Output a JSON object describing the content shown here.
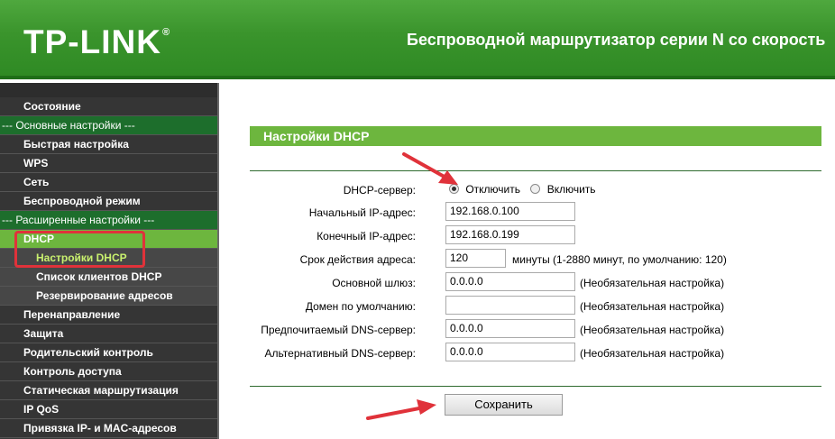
{
  "header": {
    "logo": "TP-LINK",
    "logo_reg": "®",
    "title": "Беспроводной маршрутизатор серии N со скорость"
  },
  "sidebar": {
    "items": [
      {
        "label": "Состояние",
        "type": "item"
      },
      {
        "label": "--- Основные настройки ---",
        "type": "section"
      },
      {
        "label": "Быстрая настройка",
        "type": "item"
      },
      {
        "label": "WPS",
        "type": "item"
      },
      {
        "label": "Сеть",
        "type": "item"
      },
      {
        "label": "Беспроводной режим",
        "type": "item"
      },
      {
        "label": "--- Расширенные настройки ---",
        "type": "section"
      },
      {
        "label": "DHCP",
        "type": "active"
      },
      {
        "label": "Настройки DHCP",
        "type": "sub-active"
      },
      {
        "label": "Список клиентов DHCP",
        "type": "sub"
      },
      {
        "label": "Резервирование адресов",
        "type": "sub"
      },
      {
        "label": "Перенаправление",
        "type": "item"
      },
      {
        "label": "Защита",
        "type": "item"
      },
      {
        "label": "Родительский контроль",
        "type": "item"
      },
      {
        "label": "Контроль доступа",
        "type": "item"
      },
      {
        "label": "Статическая маршрутизация",
        "type": "item"
      },
      {
        "label": "IP QoS",
        "type": "item"
      },
      {
        "label": "Привязка IP- и MAC-адресов",
        "type": "item"
      }
    ]
  },
  "panel": {
    "title": "Настройки DHCP",
    "dhcp_server_label": "DHCP-сервер:",
    "radio_disable": "Отключить",
    "radio_enable": "Включить",
    "selected": "Отключить",
    "start_ip_label": "Начальный IP-адрес:",
    "start_ip": "192.168.0.100",
    "end_ip_label": "Конечный IP-адрес:",
    "end_ip": "192.168.0.199",
    "lease_label": "Срок действия адреса:",
    "lease": "120",
    "lease_note": "минуты (1-2880 минут, по умолчанию: 120)",
    "gateway_label": "Основной шлюз:",
    "gateway": "0.0.0.0",
    "domain_label": "Домен по умолчанию:",
    "domain": "",
    "dns1_label": "Предпочитаемый DNS-сервер:",
    "dns1": "0.0.0.0",
    "dns2_label": "Альтернативный DNS-сервер:",
    "dns2": "0.0.0.0",
    "optional_note": "(Необязательная настройка)",
    "save_label": "Сохранить"
  },
  "colors": {
    "header_green": "#3a942c",
    "section_green": "#1d6e2c",
    "active_green": "#6db63e",
    "highlight_red": "#e0323a"
  }
}
